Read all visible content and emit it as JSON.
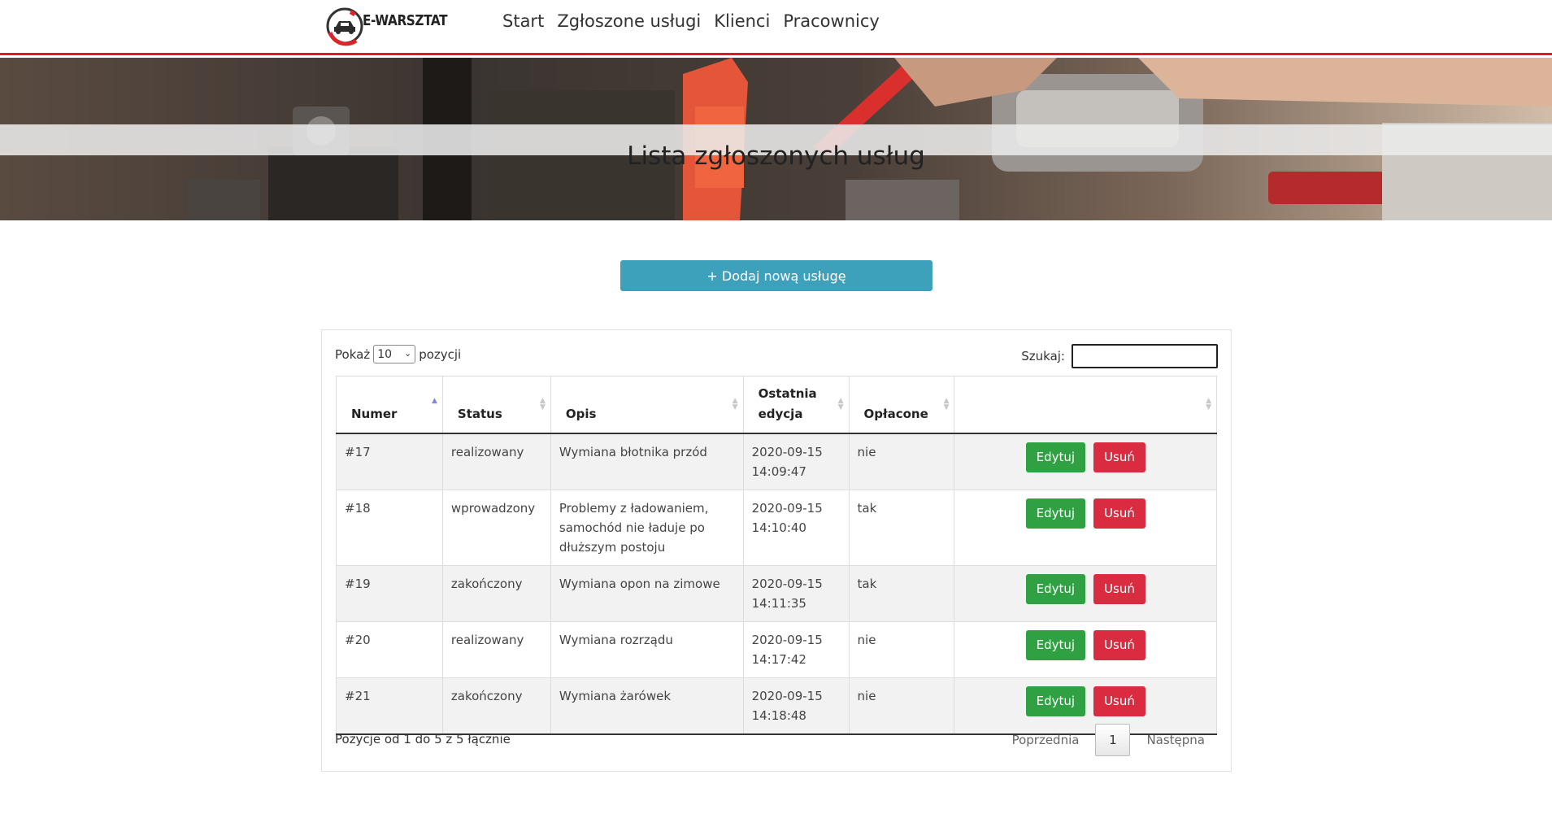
{
  "brand": {
    "name": "E-WARSZTAT"
  },
  "nav": {
    "items": [
      {
        "label": "Start"
      },
      {
        "label": "Zgłoszone usługi"
      },
      {
        "label": "Klienci"
      },
      {
        "label": "Pracownicy"
      }
    ]
  },
  "hero": {
    "title": "Lista zgłoszonych usług"
  },
  "actions": {
    "add_label": "+ Dodaj nową usługę"
  },
  "table_controls": {
    "show_prefix": "Pokaż",
    "page_size": "10",
    "show_suffix": "pozycji",
    "search_label": "Szukaj:",
    "search_value": ""
  },
  "table": {
    "columns": [
      "Numer",
      "Status",
      "Opis",
      "Ostatnia edycja",
      "Opłacone",
      ""
    ],
    "sorted_column": "Numer",
    "rows": [
      {
        "number": "#17",
        "status": "realizowany",
        "description": "Wymiana błotnika przód",
        "edited": "2020-09-15 14:09:47",
        "paid": "nie"
      },
      {
        "number": "#18",
        "status": "wprowadzony",
        "description": "Problemy z ładowaniem, samochód nie ładuje po dłuższym postoju",
        "edited": "2020-09-15 14:10:40",
        "paid": "tak"
      },
      {
        "number": "#19",
        "status": "zakończony",
        "description": "Wymiana opon na zimowe",
        "edited": "2020-09-15 14:11:35",
        "paid": "tak"
      },
      {
        "number": "#20",
        "status": "realizowany",
        "description": "Wymiana rozrządu",
        "edited": "2020-09-15 14:17:42",
        "paid": "nie"
      },
      {
        "number": "#21",
        "status": "zakończony",
        "description": "Wymiana żarówek",
        "edited": "2020-09-15 14:18:48",
        "paid": "nie"
      }
    ],
    "row_actions": {
      "edit_label": "Edytuj",
      "delete_label": "Usuń"
    }
  },
  "footer": {
    "info": "Pozycje od 1 do 5 z 5 łącznie",
    "prev_label": "Poprzednia",
    "current_page": "1",
    "next_label": "Następna"
  },
  "colors": {
    "brand_red": "#e4191f",
    "add_button": "#3ea1bc",
    "edit_button": "#2fa142",
    "delete_button": "#d92c40"
  },
  "icons": [
    "car-wrench-logo-icon",
    "sort-asc-icon",
    "sort-both-icon",
    "select-chevron-icon"
  ]
}
